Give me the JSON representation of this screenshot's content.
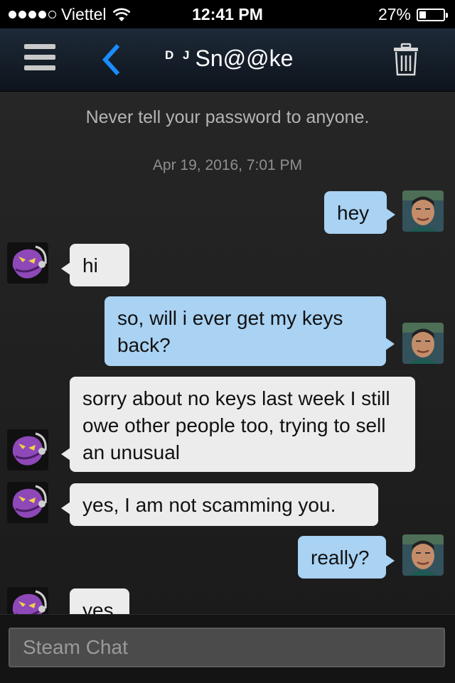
{
  "status_bar": {
    "carrier": "Viettel",
    "time": "12:41 PM",
    "battery": "27%",
    "battery_level": 0.27,
    "signal_bars": 4
  },
  "header": {
    "title_prefix": "D J",
    "title": "Sn@@ke",
    "accent_color": "#1a8cff",
    "icons": [
      "menu-icon",
      "back-chevron-icon",
      "trash-icon"
    ]
  },
  "chat": {
    "notice": "Never tell your password to anyone.",
    "timestamp": "Apr 19, 2016, 7:01 PM",
    "messages": [
      {
        "direction": "outgoing",
        "text": "hey"
      },
      {
        "direction": "incoming",
        "text": "hi"
      },
      {
        "direction": "outgoing",
        "text": "so, will i ever get my keys back?"
      },
      {
        "direction": "incoming",
        "text": "sorry about no keys last week I still owe other people too, trying to sell an unusual"
      },
      {
        "direction": "incoming",
        "text": "yes, I am not scamming you."
      },
      {
        "direction": "outgoing",
        "text": "really?"
      },
      {
        "direction": "incoming",
        "text": "yes"
      }
    ]
  },
  "input": {
    "placeholder": "Steam Chat",
    "value": ""
  }
}
